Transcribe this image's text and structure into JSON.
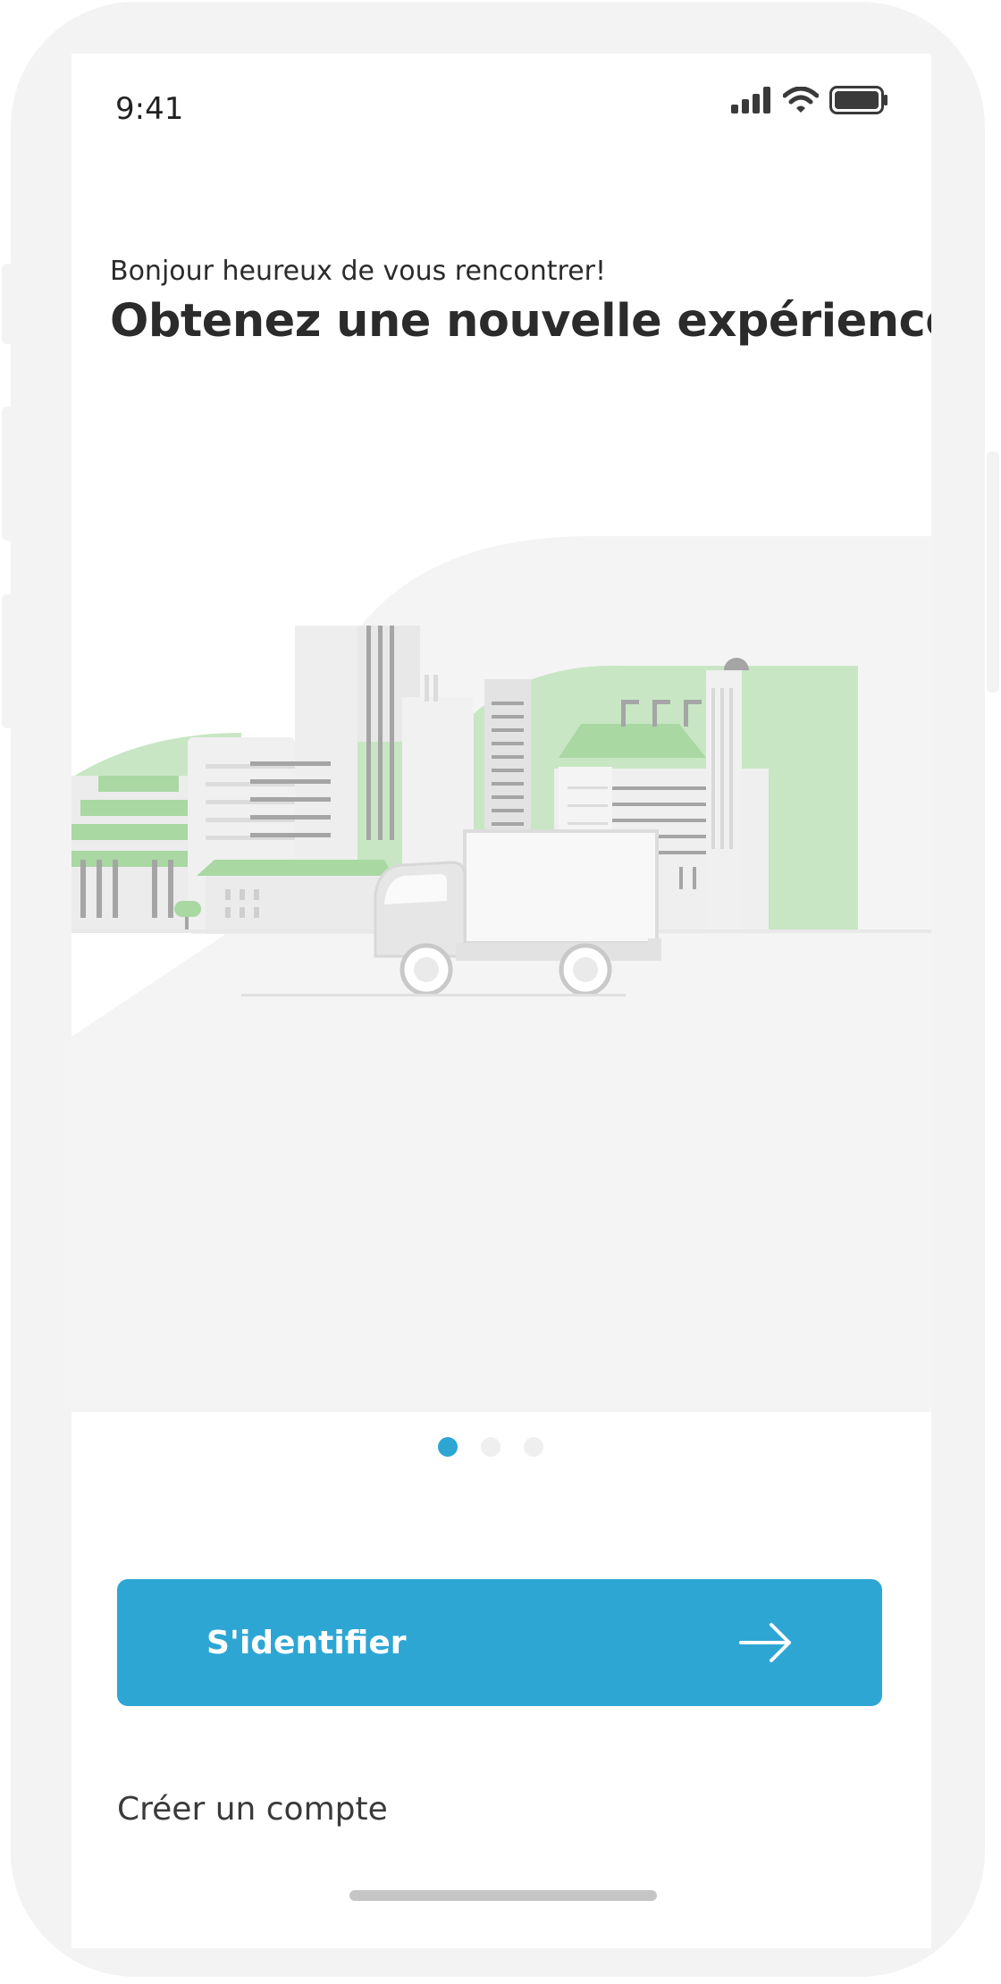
{
  "status_bar": {
    "time": "9:41",
    "icons": [
      "signal-icon",
      "wifi-icon",
      "battery-icon"
    ]
  },
  "intro": {
    "greeting": "Bonjour heureux de vous rencontrer!",
    "headline": "Obtenez une nouvelle expérience"
  },
  "illustration": {
    "name": "city-truck-illustration"
  },
  "pager": {
    "count": 3,
    "active": 0
  },
  "actions": {
    "signin_label": "S'identifier",
    "signin_icon": "arrow-right-icon",
    "create_account_label": "Créer un compte"
  },
  "colors": {
    "accent": "#2ea6d4",
    "green": "#c3e3bd",
    "text": "#2b2b2b"
  }
}
